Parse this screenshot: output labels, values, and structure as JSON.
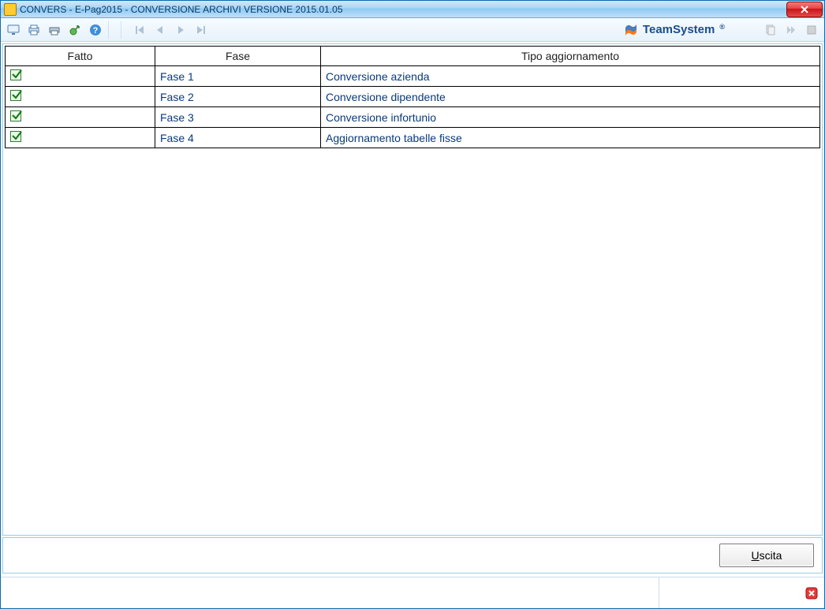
{
  "window": {
    "title": "CONVERS  - E-Pag2015  -  CONVERSIONE ARCHIVI VERSIONE 2015.01.05"
  },
  "brand": {
    "name": "TeamSystem"
  },
  "table": {
    "headers": {
      "fatto": "Fatto",
      "fase": "Fase",
      "tipo": "Tipo aggiornamento"
    },
    "rows": [
      {
        "fatto": true,
        "fase": "Fase  1",
        "tipo": "Conversione azienda"
      },
      {
        "fatto": true,
        "fase": "Fase  2",
        "tipo": "Conversione dipendente"
      },
      {
        "fatto": true,
        "fase": "Fase  3",
        "tipo": "Conversione infortunio"
      },
      {
        "fatto": true,
        "fase": "Fase  4",
        "tipo": "Aggiornamento tabelle fisse"
      }
    ]
  },
  "buttons": {
    "exit_accel": "U",
    "exit_rest": "scita"
  }
}
